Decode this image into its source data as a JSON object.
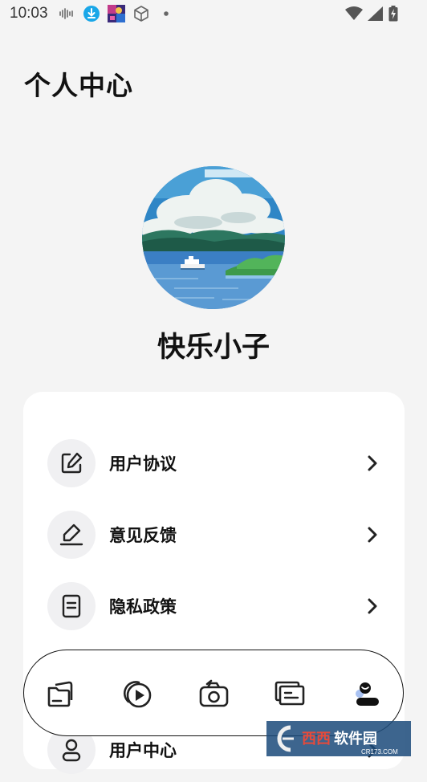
{
  "status_bar": {
    "time": "10:03",
    "icons": [
      "audio-wave-icon",
      "download-icon",
      "app-thumbnail-icon",
      "cube-icon",
      "dot-icon",
      "wifi-icon",
      "signal-icon",
      "battery-charging-icon"
    ]
  },
  "page": {
    "title": "个人中心"
  },
  "profile": {
    "username": "快乐小子"
  },
  "menu": {
    "items": [
      {
        "label": "用户协议",
        "icon": "edit-document-icon"
      },
      {
        "label": "意见反馈",
        "icon": "pen-feedback-icon"
      },
      {
        "label": "隐私政策",
        "icon": "policy-document-icon"
      },
      {
        "label": "用户中心",
        "icon": "user-icon"
      }
    ]
  },
  "tabbar": {
    "tabs": [
      "files-icon",
      "play-icon",
      "camera-icon",
      "gallery-icon",
      "profile-icon"
    ],
    "active_index": 4
  },
  "watermark": {
    "brand": "西西软件园",
    "url": "CR173.COM"
  },
  "colors": {
    "background": "#f4f4f4",
    "card": "#ffffff",
    "icon_circle": "#f0f0f2",
    "active_tab_accent": "#a9c2f2",
    "download_blue": "#1aa7e8"
  }
}
